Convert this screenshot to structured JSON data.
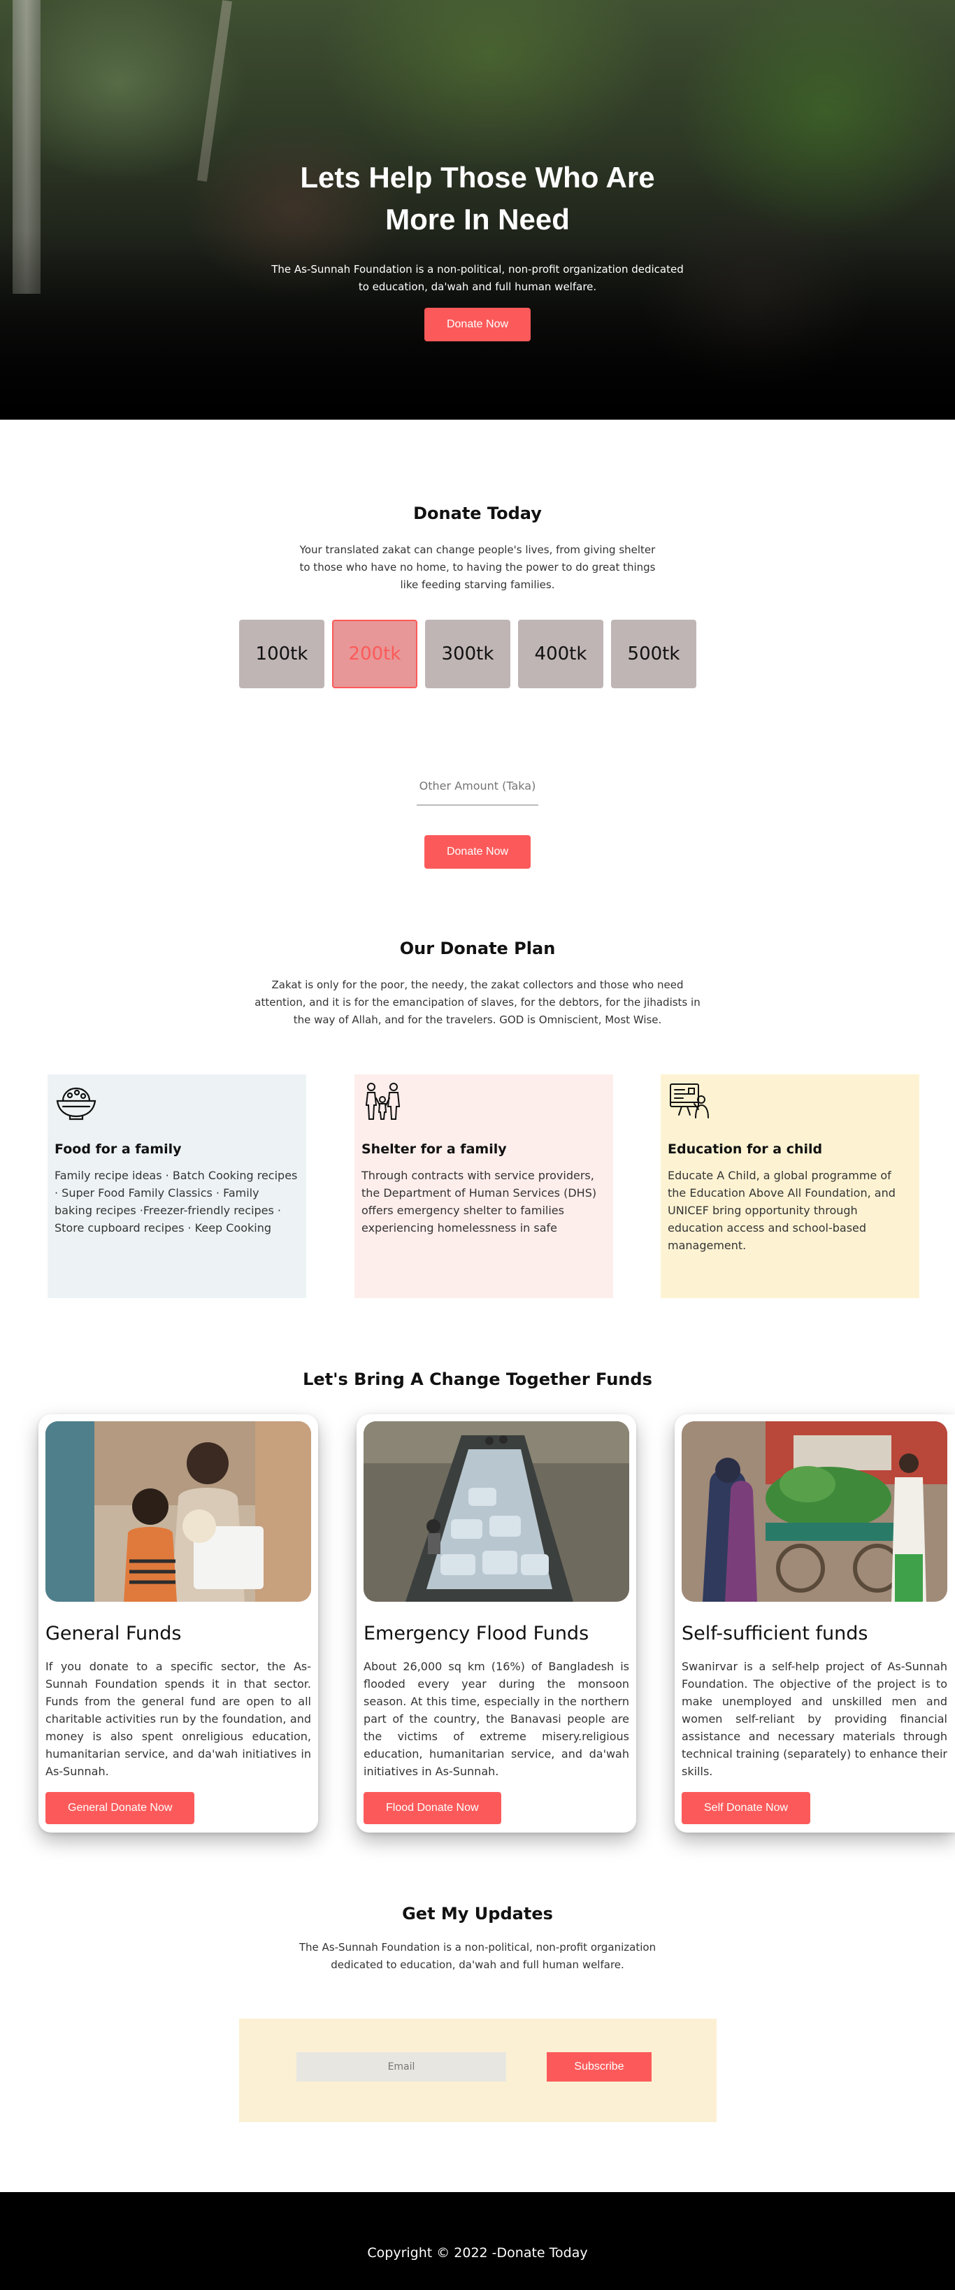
{
  "hero": {
    "title": "Lets Help Those Who Are More In Need",
    "subtitle": "The As-Sunnah Foundation is a non-political, non-profit organization dedicated to education, da'wah and full human welfare.",
    "button": "Donate Now"
  },
  "donate_today": {
    "title": "Donate Today",
    "text": "Your translated zakat can change people's lives, from giving shelter to those who have no home, to having the power to do great things like feeding starving families.",
    "amounts": [
      "100tk",
      "200tk",
      "300tk",
      "400tk",
      "500tk"
    ],
    "selected_amount": "200tk",
    "other_placeholder": "Other Amount (Taka)",
    "button": "Donate Now"
  },
  "plan": {
    "title": "Our Donate Plan",
    "text": "Zakat is only for the poor, the needy, the zakat collectors and those who need attention, and it is for the emancipation of slaves, for the debtors, for the jihadists in the way of Allah, and for the travelers. GOD is Omniscient, Most Wise.",
    "cards": [
      {
        "title": "Food for a family",
        "text": "Family recipe ideas · Batch Cooking recipes · Super Food Family Classics · Family baking recipes ·Freezer-friendly recipes · Store cupboard recipes · Keep Cooking",
        "icon": "food-bowl-icon",
        "bg": "#edf3f5"
      },
      {
        "title": "Shelter for a family",
        "text": "Through contracts with service providers, the Department of Human Services (DHS) offers emergency shelter to families experiencing homelessness in safe",
        "icon": "family-icon",
        "bg": "#fdeeec"
      },
      {
        "title": "Education for a child",
        "text": "Educate A Child, a global programme of the Education Above All Foundation, and UNICEF bring opportunity through education access and school-based management.",
        "icon": "education-icon",
        "bg": "#fdf3d3"
      }
    ]
  },
  "funds": {
    "title": "Let's Bring A Change Together Funds",
    "cards": [
      {
        "title": "General Funds",
        "text": "If you donate to a specific sector, the As-Sunnah Foundation spends it in that sector. Funds from the general fund are open to all charitable activities run by the foundation, and money is also spent onreligious education, humanitarian service, and da'wah initiatives in As-Sunnah.",
        "button": "General Donate Now"
      },
      {
        "title": "Emergency Flood Funds",
        "text": "About 26,000 sq km (16%) of Bangladesh is flooded every year during the monsoon season. At this time, especially in the northern part of the country, the Banavasi people are the victims of extreme misery.religious education, humanitarian service, and da'wah initiatives in As-Sunnah.",
        "button": "Flood Donate Now"
      },
      {
        "title": "Self-sufficient funds",
        "text": "Swanirvar is a self-help project of As-Sunnah Foundation. The objective of the project is to make unemployed and unskilled men and women self-reliant by providing financial assistance and necessary materials through technical training (separately) to enhance their skills.",
        "button": "Self Donate Now"
      }
    ]
  },
  "updates": {
    "title": "Get My Updates",
    "text": "The As-Sunnah Foundation is a non-political, non-profit organization dedicated to education, da'wah and full human welfare.",
    "email_placeholder": "Email",
    "button": "Subscribe"
  },
  "footer": {
    "copyright": "Copyright © 2022 -Donate Today"
  },
  "colors": {
    "accent": "#fc5a5a",
    "amount_box": "#c0b5b5",
    "subscribe_bg": "#fcf0d4"
  }
}
